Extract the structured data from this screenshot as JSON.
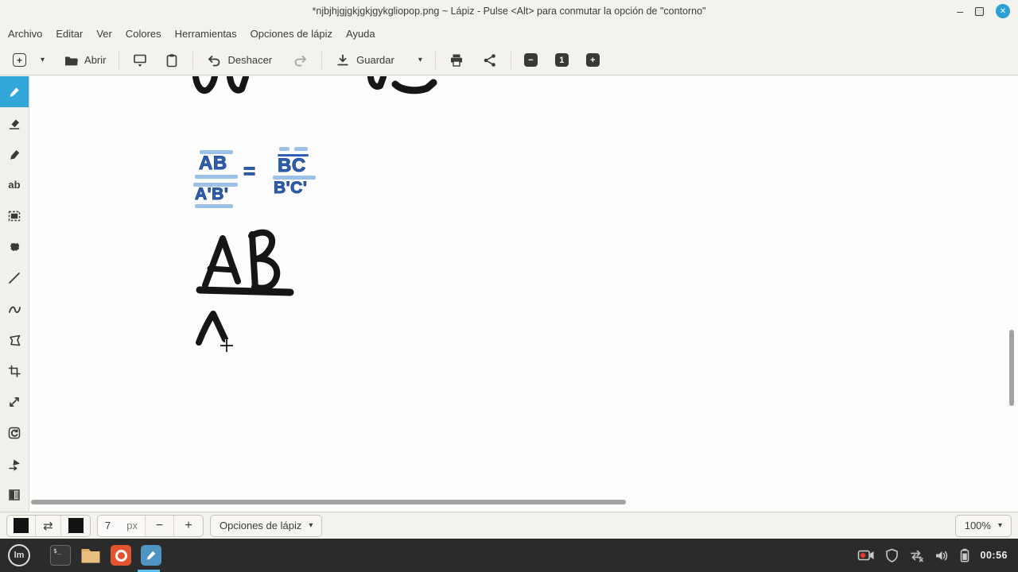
{
  "titlebar": {
    "title": "*njbjhjgjgkjgkjgykgliopop.png ~ Lápiz - Pulse <Alt> para conmutar la opción de \"contorno\"",
    "minimize_glyph": "–",
    "close_glyph": "✕"
  },
  "menubar": {
    "items": [
      {
        "label": "Archivo"
      },
      {
        "label": "Editar"
      },
      {
        "label": "Ver"
      },
      {
        "label": "Colores"
      },
      {
        "label": "Herramientas"
      },
      {
        "label": "Opciones de lápiz"
      },
      {
        "label": "Ayuda"
      }
    ]
  },
  "toolbar": {
    "new_glyph": "+",
    "caret_glyph": "▾",
    "open_label": "Abrir",
    "undo_label": "Deshacer",
    "save_label": "Guardar",
    "zoom_out_glyph": "−",
    "zoom_reset_label": "1",
    "zoom_in_glyph": "+"
  },
  "sidebar": {
    "text_tool_label": "ab"
  },
  "canvas": {
    "equation": {
      "numerator_left": "AB",
      "denominator_left": "A'B'",
      "equals": "=",
      "numerator_right": "BC",
      "denominator_right": "B'C'"
    },
    "handwritten_text": "AB"
  },
  "optionsbar": {
    "swap_colors_glyph": "⇄",
    "size_value": "7",
    "size_unit": "px",
    "decrease_glyph": "−",
    "increase_glyph": "+",
    "pen_options_label": "Opciones de lápiz",
    "caret_glyph": "▾",
    "zoom_value": "100%"
  },
  "taskbar": {
    "clock": "00:56"
  },
  "colors": {
    "accent_blue": "#32a6d9",
    "close_button_blue": "#2aa0d6",
    "equation_dark_blue": "#2e62b4",
    "equation_light_blue": "#9dc2ea",
    "ink_black": "#161616",
    "taskbar_bg": "#2b2b2b",
    "active_app_indicator": "#5bc0ee"
  }
}
